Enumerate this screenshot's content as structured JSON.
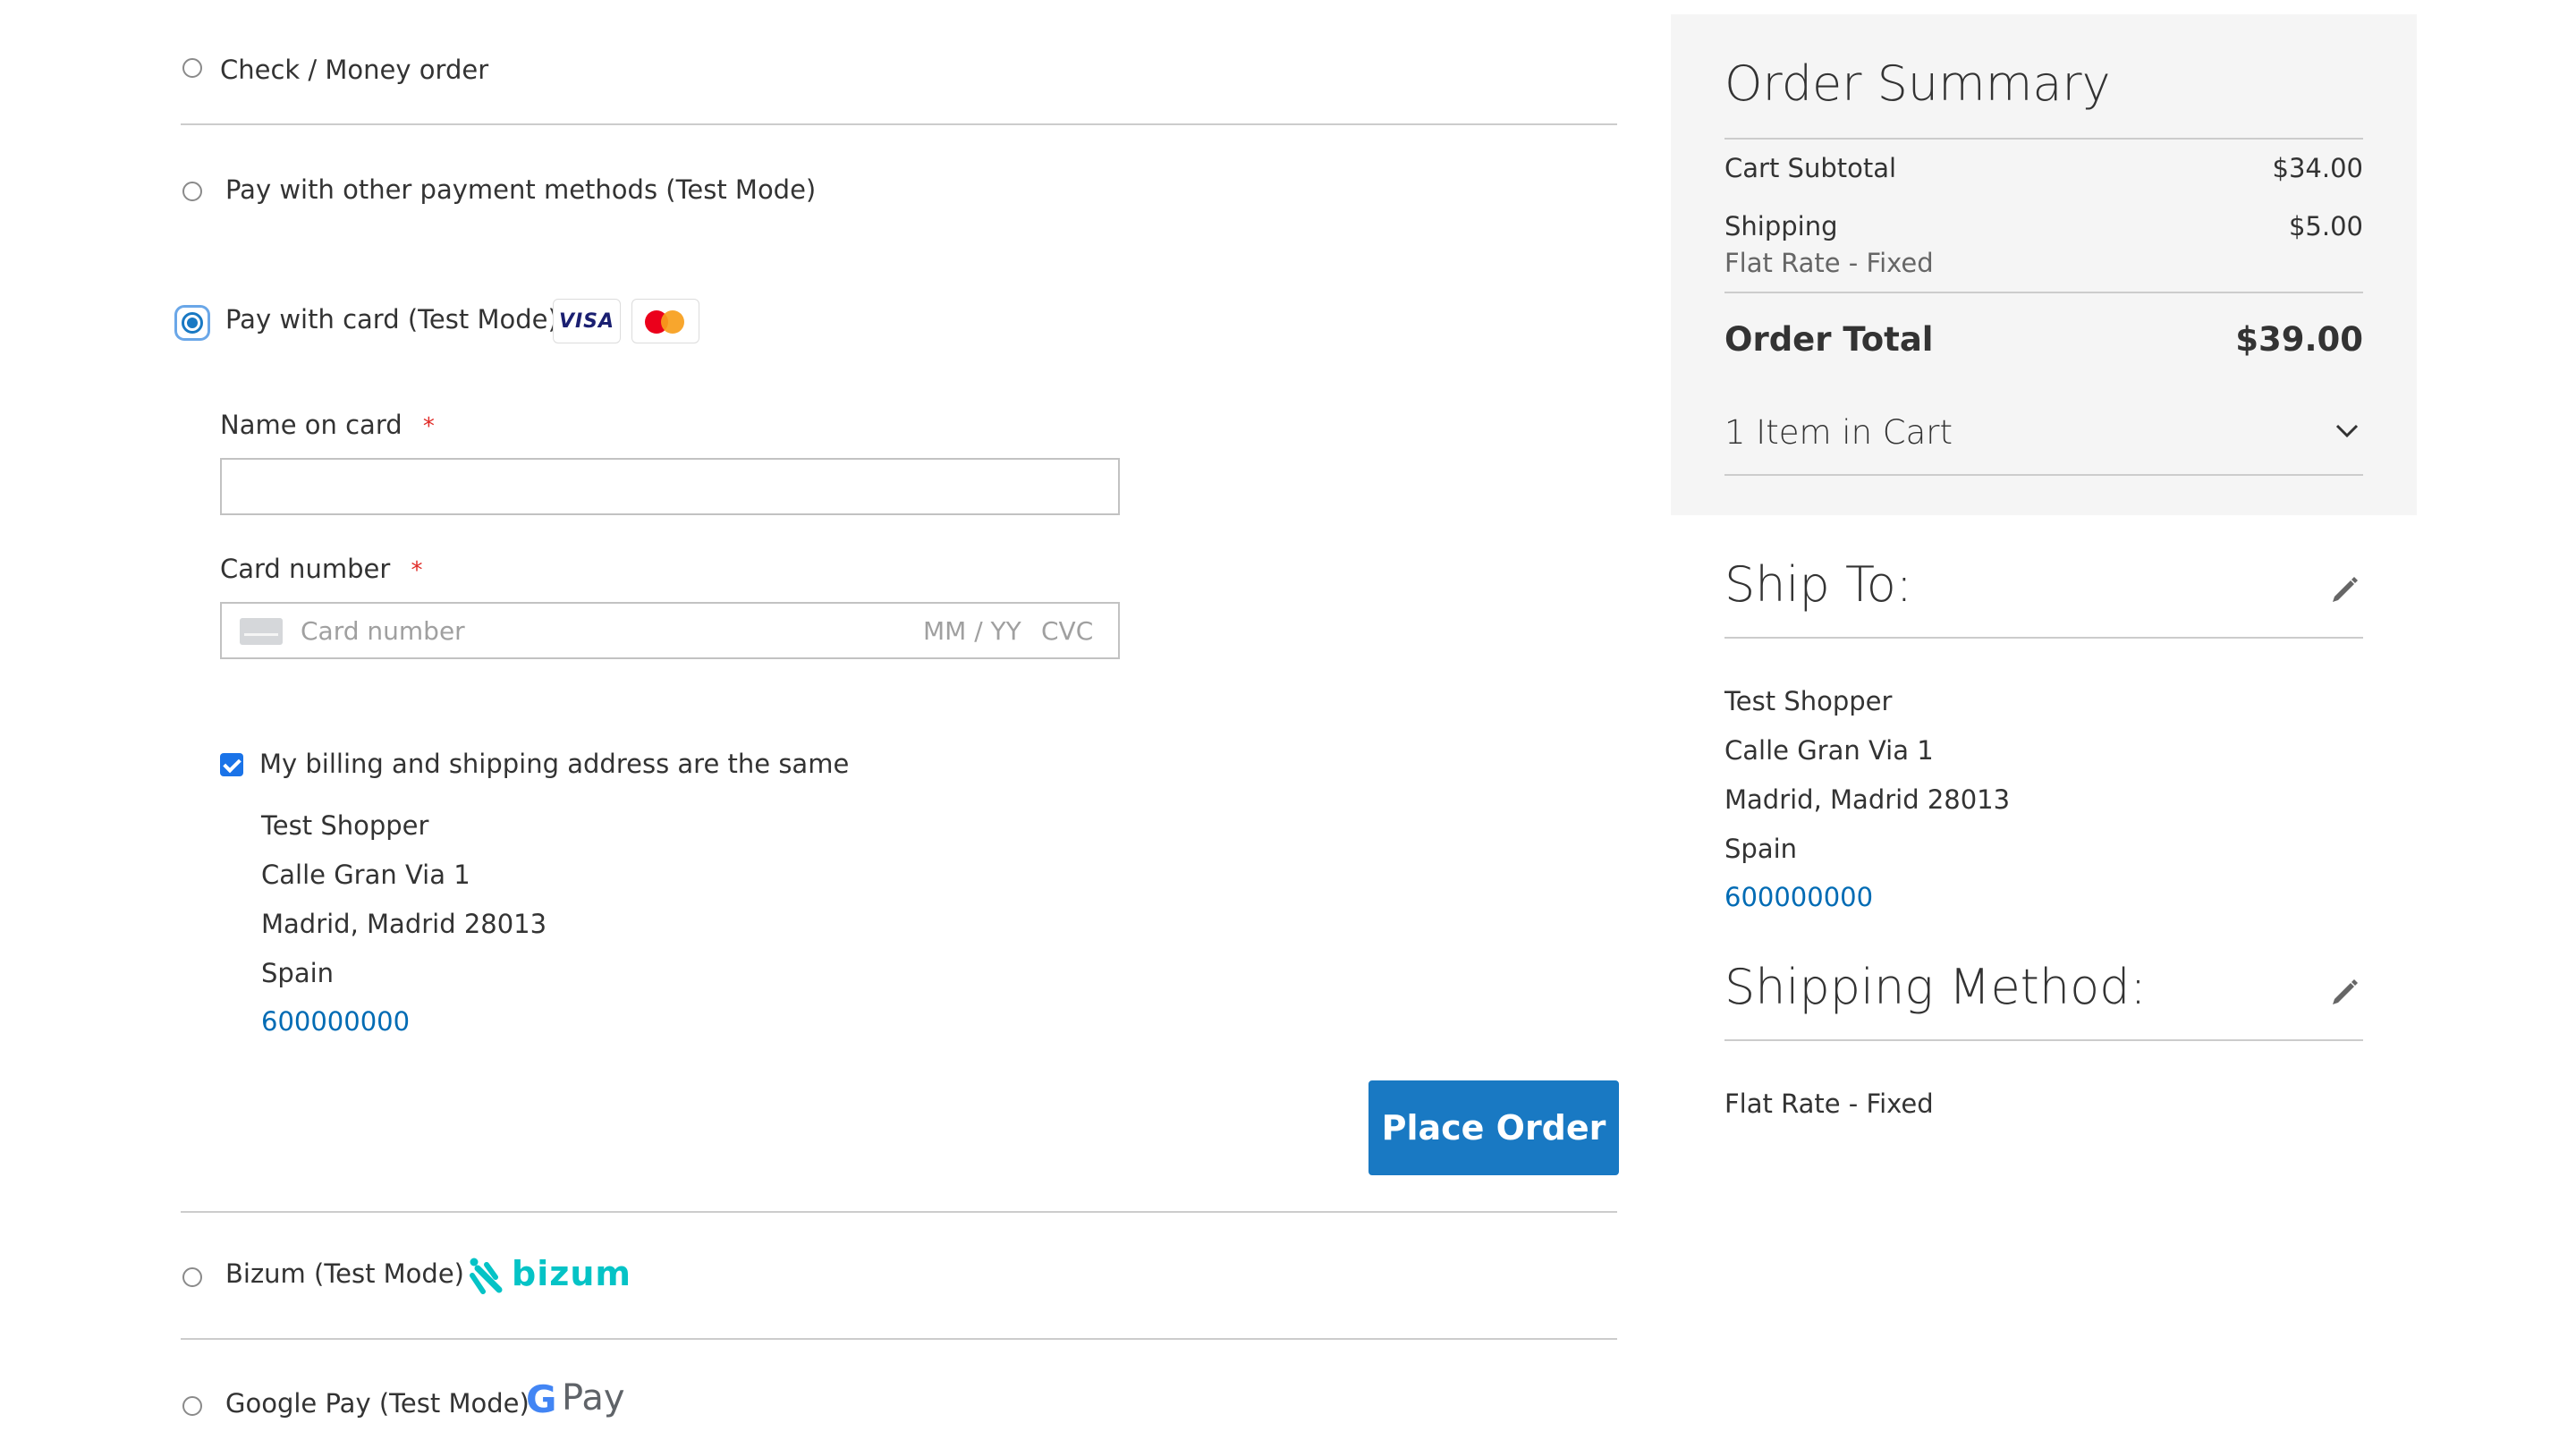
{
  "payment_methods": {
    "check_money_order": {
      "label": "Check / Money order"
    },
    "other_methods": {
      "label": "Pay with other payment methods (Test Mode)"
    },
    "card": {
      "label": "Pay with card (Test Mode)",
      "brand_visa": "VISA",
      "name_on_card_label": "Name on card",
      "required_marker": "*",
      "name_value": "",
      "card_number_label": "Card number",
      "card_number_placeholder": "Card number",
      "expiry_placeholder": "MM / YY",
      "cvc_placeholder": "CVC"
    },
    "billing_same": {
      "label": "My billing and shipping address are the same",
      "checked": true,
      "address": {
        "name": "Test Shopper",
        "street": "Calle Gran Via 1",
        "city_line": "Madrid, Madrid 28013",
        "country": "Spain",
        "phone": "600000000"
      }
    },
    "place_order_label": "Place Order",
    "bizum": {
      "label": "Bizum (Test Mode)",
      "logo_text": "bizum"
    },
    "google_pay": {
      "label": "Google Pay (Test Mode)",
      "logo_g": "G",
      "logo_pay": "Pay"
    }
  },
  "order_summary": {
    "title": "Order Summary",
    "cart_subtotal_label": "Cart Subtotal",
    "cart_subtotal_value": "$34.00",
    "shipping_label": "Shipping",
    "shipping_value": "$5.00",
    "shipping_method_name": "Flat Rate - Fixed",
    "order_total_label": "Order Total",
    "order_total_value": "$39.00",
    "items_in_cart": "1 Item in Cart"
  },
  "ship_to": {
    "title": "Ship To:",
    "name": "Test Shopper",
    "street": "Calle Gran Via 1",
    "city_line": "Madrid, Madrid 28013",
    "country": "Spain",
    "phone": "600000000"
  },
  "shipping_method": {
    "title": "Shipping Method:",
    "value": "Flat Rate - Fixed"
  },
  "colors": {
    "primary_button": "#1979c3",
    "link": "#006bb4",
    "required": "#e02b27",
    "sidebar_bg": "#f5f5f5",
    "bizum": "#05c3c6"
  }
}
